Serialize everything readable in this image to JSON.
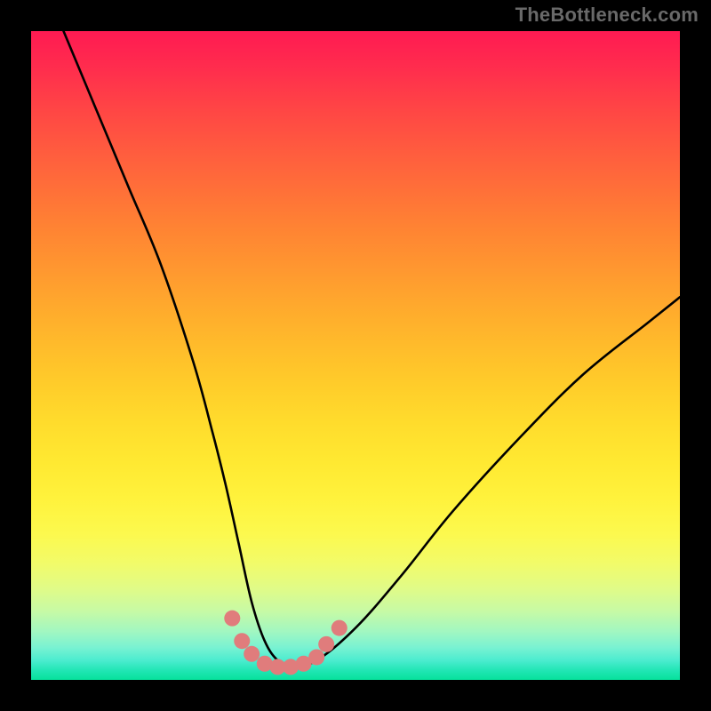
{
  "watermark": "TheBottleneck.com",
  "chart_data": {
    "type": "line",
    "title": "",
    "xlabel": "",
    "ylabel": "",
    "xlim": [
      0,
      100
    ],
    "ylim": [
      0,
      100
    ],
    "grid": false,
    "legend": false,
    "series": [
      {
        "name": "bottleneck-curve",
        "color": "#000000",
        "x": [
          0,
          5,
          10,
          15,
          20,
          25,
          28,
          30,
          32,
          34,
          36,
          38,
          40,
          44,
          50,
          57,
          65,
          75,
          85,
          95,
          100
        ],
        "values": [
          112,
          100,
          88,
          76,
          64,
          49,
          38,
          30,
          21,
          12,
          6,
          3,
          2,
          3,
          8,
          16,
          26,
          37,
          47,
          55,
          59
        ]
      }
    ],
    "markers": {
      "name": "fit-markers",
      "color": "#e07c7c",
      "points": [
        {
          "x": 31.0,
          "y": 9.5
        },
        {
          "x": 32.5,
          "y": 6.0
        },
        {
          "x": 34.0,
          "y": 4.0
        },
        {
          "x": 36.0,
          "y": 2.5
        },
        {
          "x": 38.0,
          "y": 2.0
        },
        {
          "x": 40.0,
          "y": 2.0
        },
        {
          "x": 42.0,
          "y": 2.5
        },
        {
          "x": 44.0,
          "y": 3.5
        },
        {
          "x": 45.5,
          "y": 5.5
        },
        {
          "x": 47.5,
          "y": 8.0
        }
      ]
    },
    "gradient_stops": [
      {
        "pos": 0,
        "color": "#ff1a52"
      },
      {
        "pos": 6,
        "color": "#ff2e4d"
      },
      {
        "pos": 12,
        "color": "#ff4545"
      },
      {
        "pos": 18,
        "color": "#ff5a3f"
      },
      {
        "pos": 24,
        "color": "#ff6e39"
      },
      {
        "pos": 30,
        "color": "#ff8233"
      },
      {
        "pos": 36,
        "color": "#ff9530"
      },
      {
        "pos": 42,
        "color": "#ffa82d"
      },
      {
        "pos": 48,
        "color": "#ffba2b"
      },
      {
        "pos": 54,
        "color": "#ffcb2a"
      },
      {
        "pos": 60,
        "color": "#ffdb2c"
      },
      {
        "pos": 66,
        "color": "#ffe831"
      },
      {
        "pos": 72,
        "color": "#fff23c"
      },
      {
        "pos": 77.5,
        "color": "#fcf94e"
      },
      {
        "pos": 82,
        "color": "#f2fb69"
      },
      {
        "pos": 86,
        "color": "#e0fb88"
      },
      {
        "pos": 89.5,
        "color": "#c6faa6"
      },
      {
        "pos": 92.5,
        "color": "#a2f7c1"
      },
      {
        "pos": 95,
        "color": "#79f2d2"
      },
      {
        "pos": 97,
        "color": "#4beccf"
      },
      {
        "pos": 98.5,
        "color": "#22e6b5"
      },
      {
        "pos": 100,
        "color": "#06e19b"
      }
    ]
  },
  "colors": {
    "frame_bg": "#000000",
    "curve": "#000000",
    "marker": "#e07c7c",
    "watermark": "#696969"
  }
}
